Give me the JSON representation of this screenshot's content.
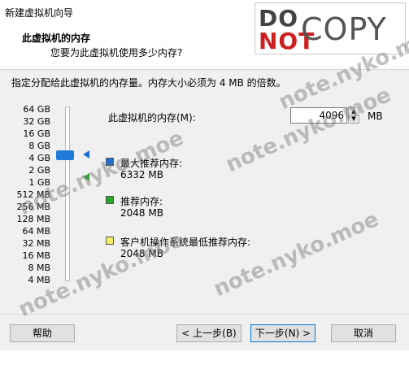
{
  "window": {
    "title": "新建虚拟机向导"
  },
  "header": {
    "title": "此虚拟机的内存",
    "subtitle": "您要为此虚拟机使用多少内存?"
  },
  "description": "指定分配给此虚拟机的内存量。内存大小必须为 4 MB 的倍数。",
  "scale": {
    "labels": [
      "64 GB",
      "32 GB",
      "16 GB",
      "8 GB",
      "4 GB",
      "2 GB",
      "1 GB",
      "512 MB",
      "256 MB",
      "128 MB",
      "64 MB",
      "32 MB",
      "16 MB",
      "8 MB",
      "4 MB"
    ]
  },
  "memory": {
    "label": "此虚拟机的内存(M):",
    "value": "4096",
    "unit": "MB"
  },
  "legend": {
    "max": {
      "label": "最大推荐内存:",
      "value": "6332 MB",
      "color": "#1f6fd0"
    },
    "recommended": {
      "label": "推荐内存:",
      "value": "2048 MB",
      "color": "#2aa52a"
    },
    "guest_min": {
      "label": "客户机操作系统最低推荐内存:",
      "value": "2048 MB",
      "color": "#f2ef66"
    }
  },
  "buttons": {
    "help": "帮助",
    "back": "< 上一步(B)",
    "next": "下一步(N) >",
    "cancel": "取消"
  },
  "watermark": {
    "stamp_do": "DO",
    "stamp_not": "NOT",
    "stamp_copy": "COPY",
    "text": "note.nyko.moe"
  }
}
